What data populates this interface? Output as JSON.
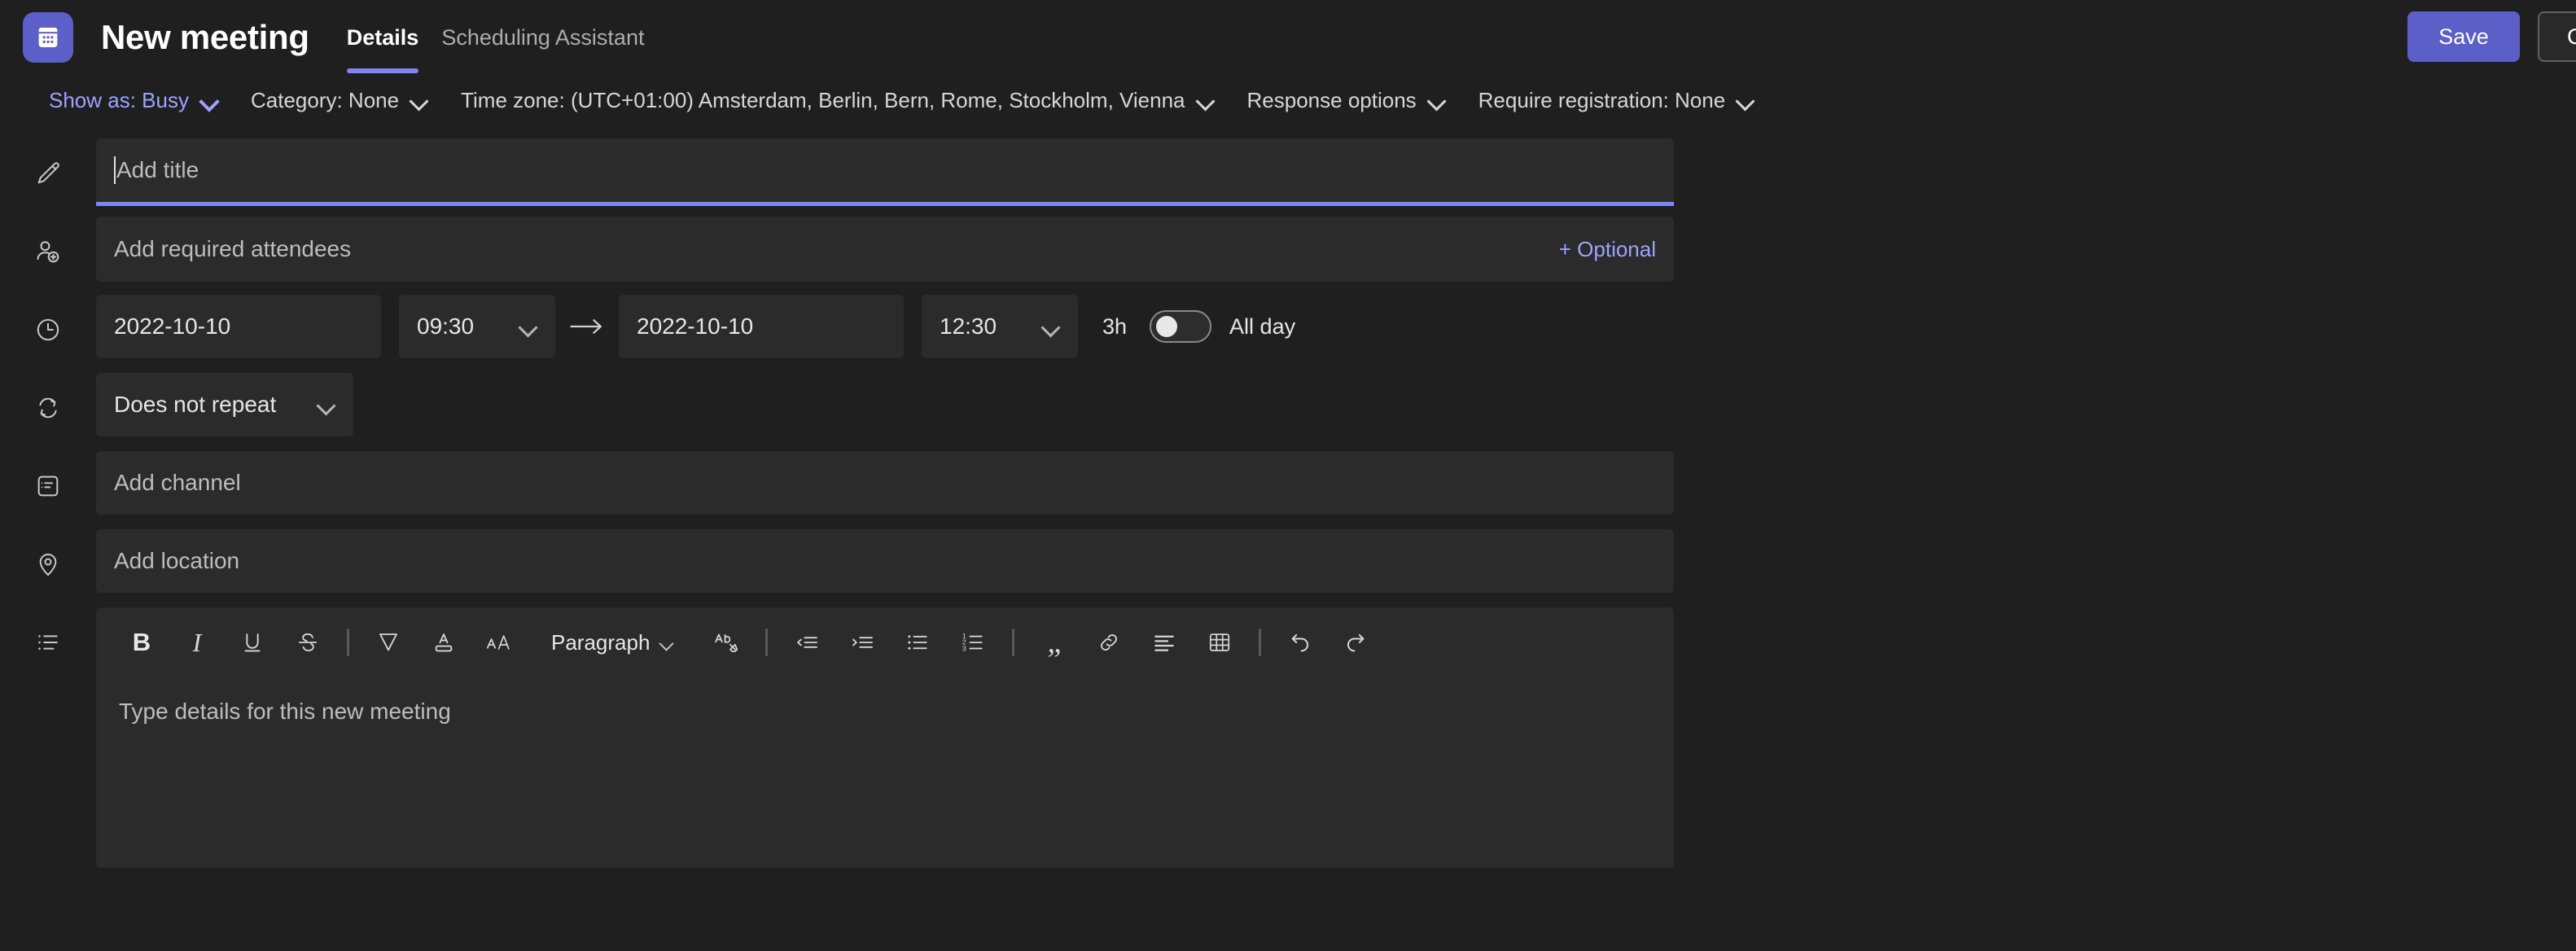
{
  "header": {
    "app_icon": "teams-calendar-icon",
    "title": "New meeting",
    "tabs": [
      {
        "label": "Details",
        "active": true
      },
      {
        "label": "Scheduling Assistant",
        "active": false
      }
    ],
    "save_label": "Save",
    "close_label": "Close"
  },
  "colors": {
    "accent": "#5b5fc7",
    "accent_text": "#9ea2ff",
    "focus_underline": "#7f85f5",
    "page_bg": "#1f1f1f",
    "field_bg": "#2b2b2b"
  },
  "options_bar": [
    {
      "label": "Show as: Busy",
      "accent": true,
      "icon": "chevron-down-icon"
    },
    {
      "label": "Category: None",
      "accent": false,
      "icon": "chevron-down-icon"
    },
    {
      "label": "Time zone: (UTC+01:00) Amsterdam, Berlin, Bern, Rome, Stockholm, Vienna",
      "accent": false,
      "icon": "chevron-down-icon"
    },
    {
      "label": "Response options",
      "accent": false,
      "icon": "chevron-down-icon"
    },
    {
      "label": "Require registration: None",
      "accent": false,
      "icon": "chevron-down-icon"
    }
  ],
  "form": {
    "title_field": {
      "icon": "pencil-icon",
      "placeholder": "Add title",
      "value": "",
      "focused": true
    },
    "attendees_field": {
      "icon": "add-person-icon",
      "placeholder": "Add required attendees",
      "value": "",
      "optional_label": "+ Optional"
    },
    "datetime": {
      "icon": "clock-icon",
      "start_date": "2022-10-10",
      "start_time": "09:30",
      "arrow": "arrow-right-icon",
      "end_date": "2022-10-10",
      "end_time": "12:30",
      "duration": "3h",
      "all_day_label": "All day",
      "all_day_on": false
    },
    "repeat": {
      "icon": "repeat-icon",
      "value": "Does not repeat"
    },
    "channel_field": {
      "icon": "channel-icon",
      "placeholder": "Add channel",
      "value": ""
    },
    "location_field": {
      "icon": "location-pin-icon",
      "placeholder": "Add location",
      "value": ""
    },
    "description": {
      "icon": "list-details-icon",
      "placeholder": "Type details for this new meeting",
      "value": "",
      "toolbar": {
        "style_dropdown": "Paragraph",
        "buttons": [
          {
            "name": "bold-icon",
            "glyph": "B"
          },
          {
            "name": "italic-icon",
            "glyph": "I"
          },
          {
            "name": "underline-icon",
            "glyph": "U"
          },
          {
            "name": "strikethrough-icon",
            "glyph": "S"
          },
          {
            "name": "highlight-icon",
            "glyph": ""
          },
          {
            "name": "font-color-icon",
            "glyph": ""
          },
          {
            "name": "font-size-icon",
            "glyph": ""
          },
          {
            "name": "clear-formatting-icon",
            "glyph": ""
          },
          {
            "name": "decrease-indent-icon",
            "glyph": ""
          },
          {
            "name": "increase-indent-icon",
            "glyph": ""
          },
          {
            "name": "bulleted-list-icon",
            "glyph": ""
          },
          {
            "name": "numbered-list-icon",
            "glyph": ""
          },
          {
            "name": "blockquote-icon",
            "glyph": ""
          },
          {
            "name": "link-icon",
            "glyph": ""
          },
          {
            "name": "align-left-icon",
            "glyph": ""
          },
          {
            "name": "table-icon",
            "glyph": ""
          },
          {
            "name": "undo-icon",
            "glyph": ""
          },
          {
            "name": "redo-icon",
            "glyph": ""
          }
        ]
      }
    }
  }
}
